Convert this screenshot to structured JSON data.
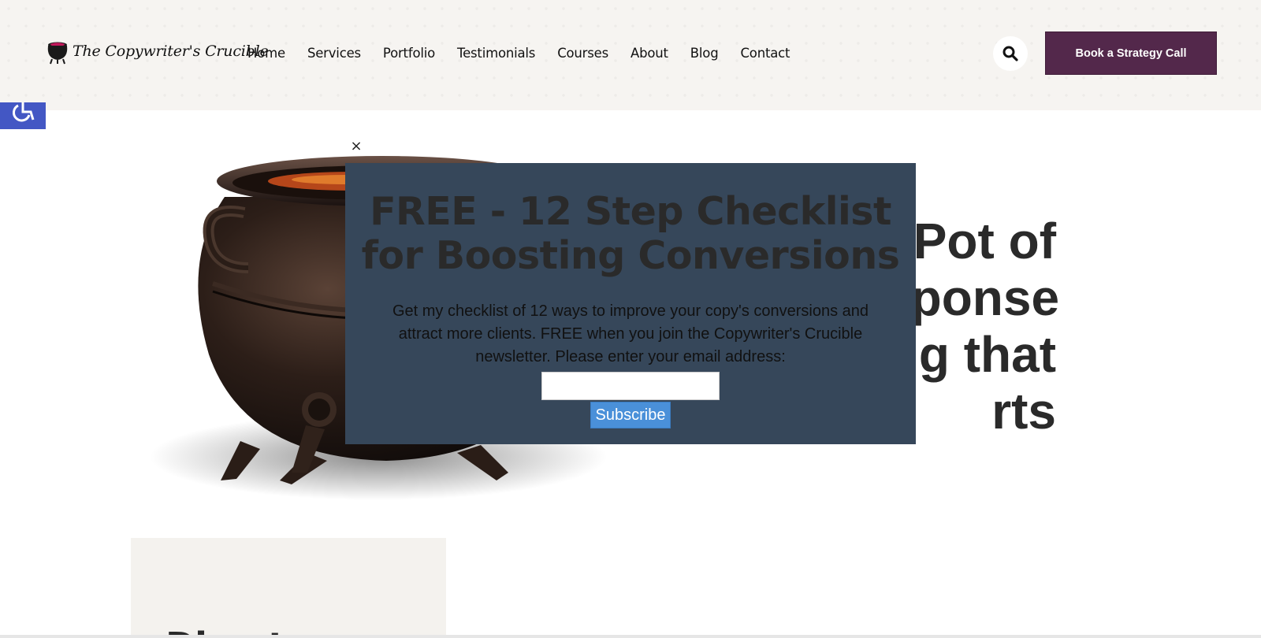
{
  "header": {
    "logo_text": "The Copywriter's Crucible",
    "nav": [
      "Home",
      "Services",
      "Portfolio",
      "Testimonials",
      "Courses",
      "About",
      "Blog",
      "Contact"
    ],
    "cta_label": "Book a Strategy Call",
    "colors": {
      "background": "#f6f4f1",
      "cta": "#53284b"
    }
  },
  "hero": {
    "heading_lines": [
      "Pot of",
      "sponse",
      "ng that",
      "rts"
    ]
  },
  "card": {
    "title": "Direct respon"
  },
  "popup": {
    "title_line1": "FREE - 12 Step Checklist",
    "title_line2": "for Boosting Conversions",
    "body": "Get my checklist of 12 ways to improve your copy's conversions and attract more clients. FREE when you join the Copywriter's Crucible newsletter. Please enter your email address:",
    "email_value": "",
    "subscribe_label": "Subscribe",
    "close_symbol": "×",
    "colors": {
      "background": "#36475a",
      "button": "#4a90d9"
    }
  },
  "icons": {
    "search": "search-icon",
    "close": "close-icon",
    "accessibility": "accessibility-icon",
    "logo": "cauldron-logo-icon"
  }
}
